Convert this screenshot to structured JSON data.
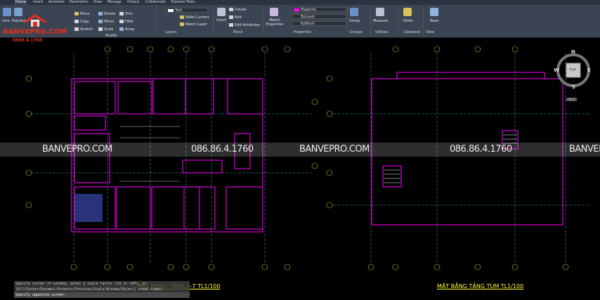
{
  "tabs": [
    "Home",
    "Insert",
    "Annotate",
    "Parametric",
    "View",
    "Manage",
    "Output",
    "Collaborate",
    "Express Tools"
  ],
  "draw": {
    "line": "Line",
    "polyline": "Polyline"
  },
  "modify": {
    "title": "Modify",
    "move": "Move",
    "rotate": "Rotate",
    "trim": "Trim",
    "copy": "Copy",
    "mirror": "Mirror",
    "fillet": "Fillet",
    "stretch": "Stretch",
    "scale": "Scale",
    "array": "Array"
  },
  "layers": {
    "title": "Layers",
    "current": "Text",
    "make_current": "Make Current",
    "match_layer": "Match Layer"
  },
  "block": {
    "title": "Block",
    "insert": "Insert",
    "create": "Create",
    "edit": "Edit",
    "edit_attributes": "Edit Attributes"
  },
  "properties": {
    "title": "Properties",
    "match": "Match Properties",
    "color": "Magenta",
    "linetype": "ByLayer",
    "lineweight": "ByBlock"
  },
  "groups": {
    "title": "Groups",
    "group": "Group"
  },
  "utilities": {
    "title": "Utilities",
    "measure": "Measure"
  },
  "clipboard": {
    "title": "Clipboard",
    "paste": "Paste"
  },
  "view": {
    "title": "View",
    "base": "Base"
  },
  "logo": {
    "brand": "BANVEPRO.COM",
    "phone": "0868.4.1760"
  },
  "watermark": {
    "site": "BANVEPRO.COM",
    "phone": "086.86.4.1760"
  },
  "command": {
    "line1": "Specify corner of window, enter a scale factor (nX or nXP), or",
    "line2": "[All/Center/Dynamic/Extents/Previous/Scale/Window/Object] <real time>:",
    "line3": "Specify opposite corner:"
  },
  "plans": {
    "left_title": "MẶT BẰNG TẦNG 3-7 TL1/100",
    "right_title": "MẶT BẰNG TẦNG TUM TL1/100"
  },
  "viewcube": {
    "n": "N",
    "s": "S",
    "e": "E",
    "w": "W",
    "top": "TOP",
    "wcs": "WCS"
  },
  "colors": {
    "accent": "#ff00ff",
    "ribbon": "#3b4453",
    "logo_red": "#e0301e",
    "title_yellow": "#ffff33"
  }
}
